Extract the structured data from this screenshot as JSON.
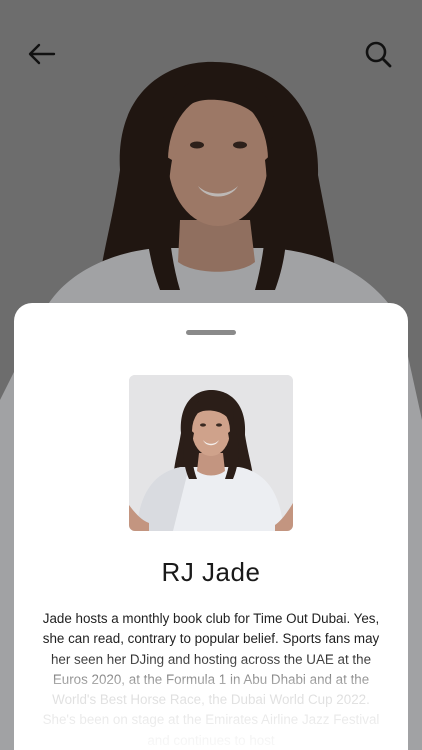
{
  "header": {
    "back_icon": "arrow-left-icon",
    "search_icon": "search-icon"
  },
  "sheet": {
    "handle": "drag-handle",
    "presenter_name": "RJ Jade",
    "bio": "Jade hosts a monthly book club for Time Out Dubai. Yes, she can read, contrary to popular belief. Sports fans may her seen her DJing and hosting across the UAE at the Euros 2020, at the Formula 1 in Abu Dhabi and at the World's Best Horse Race, the Dubai World Cup 2022. She's been on stage at the Emirates Airline Jazz Festival and continues to host"
  },
  "colors": {
    "hero_overlay": "#7c7c7c",
    "sheet_background": "#ffffff",
    "handle": "#8a8a8a",
    "text": "#1a1a1a",
    "portrait_background": "#e4e4e6"
  }
}
